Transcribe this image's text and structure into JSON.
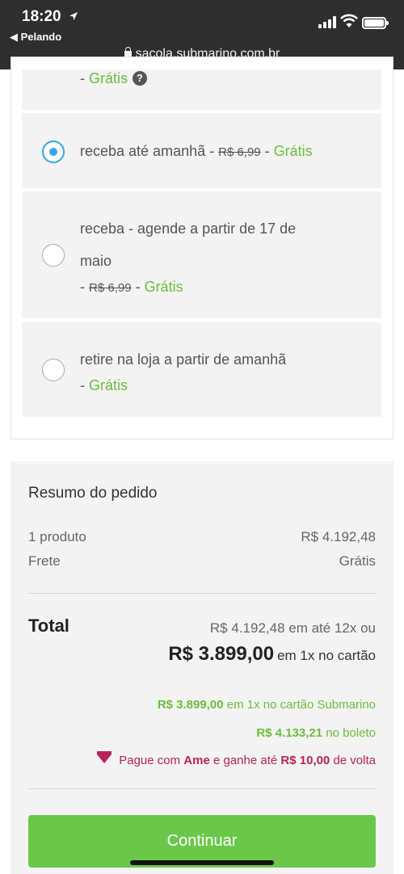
{
  "status_bar": {
    "time": "18:20",
    "back_app": "◀ Pelando",
    "url": "sacola.submarino.com.br"
  },
  "shipping": {
    "partial_option": {
      "dash": "-",
      "price": "Grátis",
      "help": "?"
    },
    "options": [
      {
        "label": "receba até amanhã",
        "sep1": " - ",
        "old_price": "R$ 6,99",
        "sep2": " - ",
        "price": "Grátis",
        "selected": true
      },
      {
        "label_line1": "receba - agende a partir de 17 de",
        "label_line2": "maio",
        "dash": "-",
        "old_price": "R$ 6,99",
        "sep": " - ",
        "price": "Grátis",
        "selected": false
      },
      {
        "label": "retire na loja a partir de amanhã",
        "dash": "-",
        "price": "Grátis",
        "selected": false
      }
    ]
  },
  "summary": {
    "title": "Resumo do pedido",
    "products_label": "1 produto",
    "products_value": "R$ 4.192,48",
    "shipping_label": "Frete",
    "shipping_value": "Grátis",
    "total_label": "Total",
    "installments": "R$ 4.192,48 em até 12x ou",
    "total_price": "R$ 3.899,00",
    "total_price_suffix": "em 1x no cartão",
    "promo_card_value": "R$ 3.899,00",
    "promo_card_text": "em 1x no cartão Submarino",
    "promo_boleto_value": "R$ 4.133,21",
    "promo_boleto_text": "no boleto",
    "ame_prefix": "Pague com",
    "ame_brand": "Ame",
    "ame_middle": "e ganhe até",
    "ame_value": "R$ 10,00",
    "ame_suffix": "de volta"
  },
  "continue_button": "Continuar",
  "colors": {
    "green": "#6cbd3c",
    "button": "#6ac74a",
    "radio_selected": "#3aa6e0",
    "ame": "#b8235a"
  }
}
